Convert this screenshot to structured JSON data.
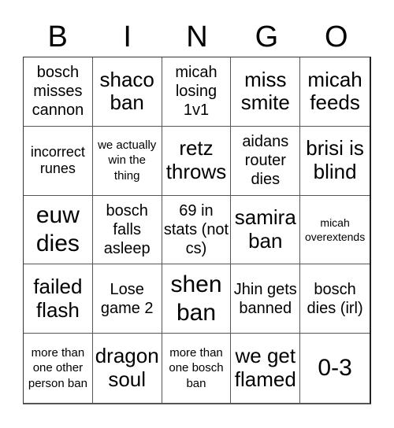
{
  "header": [
    "B",
    "I",
    "N",
    "G",
    "O"
  ],
  "cells": [
    {
      "text": "bosch misses cannon",
      "size": "s-m"
    },
    {
      "text": "shaco ban",
      "size": "s-l"
    },
    {
      "text": "micah losing 1v1",
      "size": "s-m"
    },
    {
      "text": "miss smite",
      "size": "s-l"
    },
    {
      "text": "micah feeds",
      "size": "s-l"
    },
    {
      "text": "incorrect runes",
      "size": "s-ms"
    },
    {
      "text": "we actually win the thing",
      "size": "s-s"
    },
    {
      "text": "retz throws",
      "size": "s-l"
    },
    {
      "text": "aidans router dies",
      "size": "s-m"
    },
    {
      "text": "brisi is blind",
      "size": "s-l"
    },
    {
      "text": "euw dies",
      "size": "s-xl"
    },
    {
      "text": "bosch falls asleep",
      "size": "s-m"
    },
    {
      "text": "69 in stats (not cs)",
      "size": "s-m"
    },
    {
      "text": "samira ban",
      "size": "s-l"
    },
    {
      "text": "micah overextends",
      "size": "s-xs"
    },
    {
      "text": "failed flash",
      "size": "s-l"
    },
    {
      "text": "Lose game 2",
      "size": "s-m"
    },
    {
      "text": "shen ban",
      "size": "s-xl"
    },
    {
      "text": "Jhin gets banned",
      "size": "s-m"
    },
    {
      "text": "bosch dies (irl)",
      "size": "s-m"
    },
    {
      "text": "more than one other person ban",
      "size": "s-s"
    },
    {
      "text": "dragon soul",
      "size": "s-l"
    },
    {
      "text": "more than one bosch ban",
      "size": "s-s"
    },
    {
      "text": "we get flamed",
      "size": "s-l"
    },
    {
      "text": "0-3",
      "size": "s-xl"
    }
  ]
}
